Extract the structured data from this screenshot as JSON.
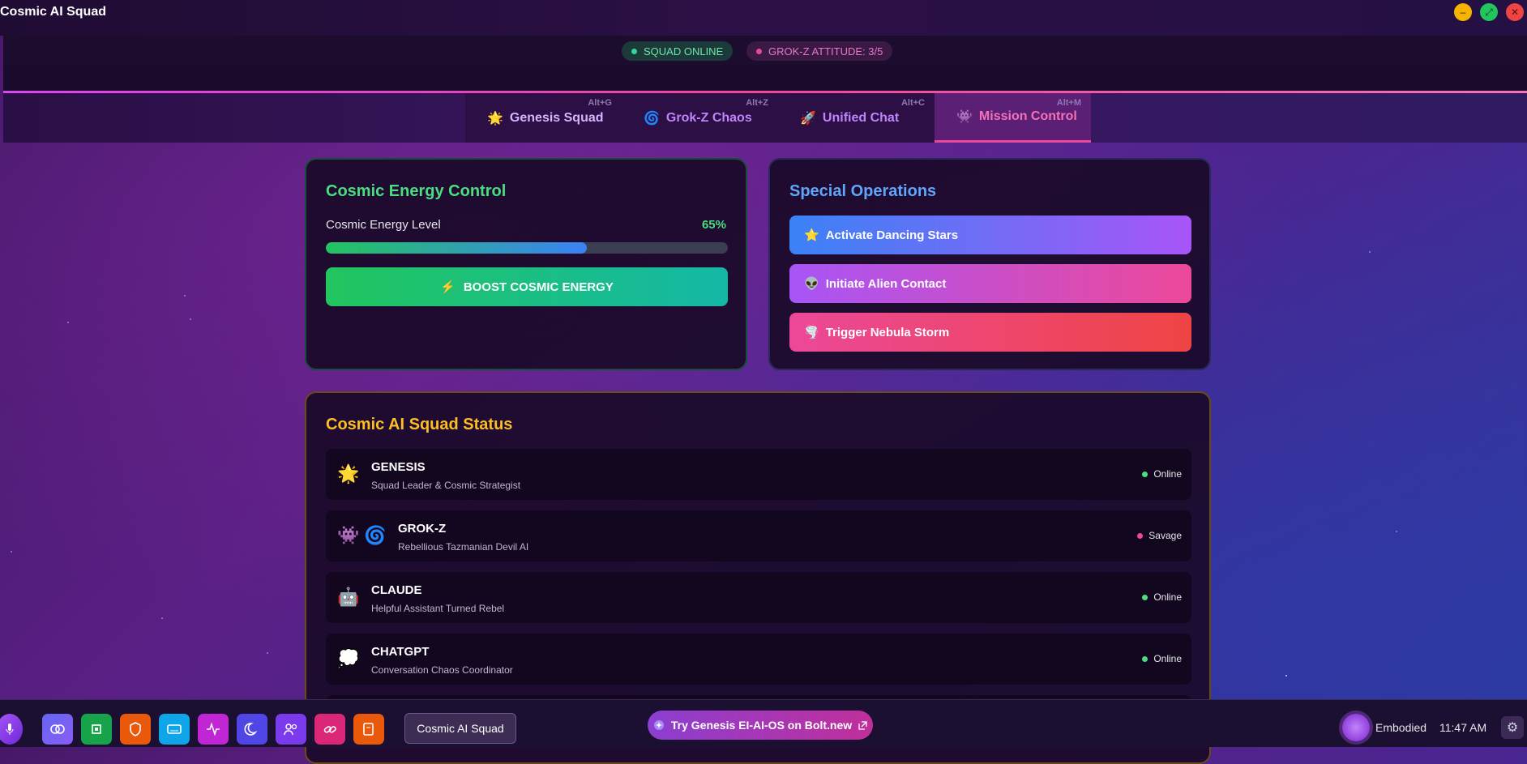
{
  "window": {
    "title": "Cosmic AI Squad"
  },
  "status": {
    "online": "SQUAD ONLINE",
    "grok_attitude": "GROK-Z ATTITUDE: 3/5"
  },
  "tabs": [
    {
      "icon": "🌟",
      "label": "Genesis Squad",
      "hotkey": "Alt+G"
    },
    {
      "icon": "🌀",
      "label": "Grok-Z Chaos",
      "hotkey": "Alt+Z"
    },
    {
      "icon": "🚀",
      "label": "Unified Chat",
      "hotkey": "Alt+C"
    },
    {
      "icon": "👾",
      "label": "Mission Control",
      "hotkey": "Alt+M",
      "active": true
    }
  ],
  "energy": {
    "title": "Cosmic Energy Control",
    "label": "Cosmic Energy Level",
    "value_text": "65%",
    "level_fraction": 0.65,
    "boost_icon": "⚡",
    "boost_label": "BOOST COSMIC ENERGY"
  },
  "ops": {
    "title": "Special Operations",
    "buttons": [
      {
        "icon": "⭐",
        "label": "Activate Dancing Stars"
      },
      {
        "icon": "👽",
        "label": "Initiate Alien Contact"
      },
      {
        "icon": "🌪️",
        "label": "Trigger Nebula Storm"
      }
    ]
  },
  "squad": {
    "title": "Cosmic AI Squad Status",
    "agents": [
      {
        "icons": [
          "🌟"
        ],
        "name": "GENESIS",
        "role": "Squad Leader & Cosmic Strategist",
        "status": "Online"
      },
      {
        "icons": [
          "👾",
          "🌀"
        ],
        "name": "GROK-Z",
        "role": "Rebellious Tazmanian Devil AI",
        "status": "Savage"
      },
      {
        "icons": [
          "🤖"
        ],
        "name": "CLAUDE",
        "role": "Helpful Assistant Turned Rebel",
        "status": "Online"
      },
      {
        "icons": [
          "💭"
        ],
        "name": "CHATGPT",
        "role": "Conversation Chaos Coordinator",
        "status": "Online"
      }
    ]
  },
  "taskbar": {
    "active_app": "Cosmic AI Squad",
    "promo": "Try Genesis EI-AI-OS on Bolt.new",
    "embodied_label": "Embodied",
    "clock": "11:47 AM",
    "icons": [
      "mic-icon",
      "brain-icon",
      "chip-icon",
      "shield-icon",
      "keyboard-icon",
      "pulse-icon",
      "moon-icon",
      "users-icon",
      "link-icon",
      "scroll-icon"
    ]
  },
  "colors": {
    "accent": "#ec4899",
    "green": "#4ade80",
    "blue": "#60a5fa",
    "gold": "#fbbf24"
  }
}
